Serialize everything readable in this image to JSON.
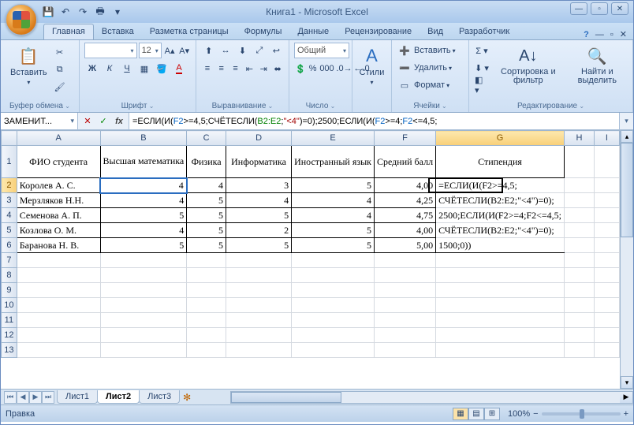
{
  "title": "Книга1 - Microsoft Excel",
  "tabs": [
    "Главная",
    "Вставка",
    "Разметка страницы",
    "Формулы",
    "Данные",
    "Рецензирование",
    "Вид",
    "Разработчик"
  ],
  "active_tab": 0,
  "ribbon": {
    "clipboard": {
      "paste": "Вставить",
      "label": "Буфер обмена"
    },
    "font": {
      "name": "",
      "size": "12",
      "label": "Шрифт"
    },
    "align": {
      "label": "Выравнивание"
    },
    "number": {
      "format": "Общий",
      "label": "Число"
    },
    "styles": {
      "btn": "Стили"
    },
    "cells": {
      "insert": "Вставить",
      "delete": "Удалить",
      "format": "Формат",
      "label": "Ячейки"
    },
    "editing": {
      "sort": "Сортировка и фильтр",
      "find": "Найти и выделить",
      "label": "Редактирование"
    }
  },
  "namebox": "ЗАМЕНИТ...",
  "formula_display": "=ЕСЛИ(И(F2>=4,5;СЧЁТЕСЛИ(B2:E2;\"<4\")=0);2500;ЕСЛИ(И(F2>=4;F2<=4,5;",
  "formula_parts": {
    "f": "=ЕСЛИ(И(",
    "r1": "F2",
    "t1": ">=4,5;СЧЁТЕСЛИ(",
    "r2": "B2:E2",
    "t2": ";",
    "s1": "\"<4\"",
    "t3": ")=0);2500;ЕСЛИ(И(",
    "r3": "F2",
    "t4": ">=4;",
    "r4": "F2",
    "t5": "<=4,5;"
  },
  "cols": {
    "A": 125,
    "B": 80,
    "C": 55,
    "D": 90,
    "E": 95,
    "F": 70,
    "G": 95,
    "H": 70,
    "I": 40
  },
  "active_col": "G",
  "active_row": 2,
  "headers": [
    "A",
    "B",
    "C",
    "D",
    "E",
    "F",
    "G",
    "H",
    "I"
  ],
  "row_headers": [
    1,
    2,
    3,
    4,
    5,
    6,
    7,
    8,
    9,
    10,
    11,
    12,
    13
  ],
  "t_head": {
    "A": "ФИО студента",
    "B": "Высшая математика",
    "C": "Физика",
    "D": "Информатика",
    "E": "Иностранный язык",
    "F": "Средний балл",
    "G": "Стипендия"
  },
  "rows": [
    {
      "A": "Королев А. С.",
      "B": "4",
      "C": "4",
      "D": "3",
      "E": "5",
      "F": "4,00"
    },
    {
      "A": "Мерзляков Н.Н.",
      "B": "4",
      "C": "5",
      "D": "4",
      "E": "4",
      "F": "4,25"
    },
    {
      "A": "Семенова А. П.",
      "B": "5",
      "C": "5",
      "D": "5",
      "E": "4",
      "F": "4,75"
    },
    {
      "A": "Козлова О. М.",
      "B": "4",
      "C": "5",
      "D": "2",
      "E": "5",
      "F": "4,00"
    },
    {
      "A": "Баранова Н. В.",
      "B": "5",
      "C": "5",
      "D": "5",
      "E": "5",
      "F": "5,00"
    }
  ],
  "spill": [
    "=ЕСЛИ(И(F2>=4,5;",
    "СЧЁТЕСЛИ(B2:E2;\"<4\")=0);",
    "2500;ЕСЛИ(И(F2>=4;F2<=4,5;",
    "СЧЁТЕСЛИ(B2:E2;\"<4\")=0);",
    "1500;0))"
  ],
  "sheets": [
    "Лист1",
    "Лист2",
    "Лист3"
  ],
  "active_sheet": 1,
  "status": "Правка",
  "zoom": "100%"
}
